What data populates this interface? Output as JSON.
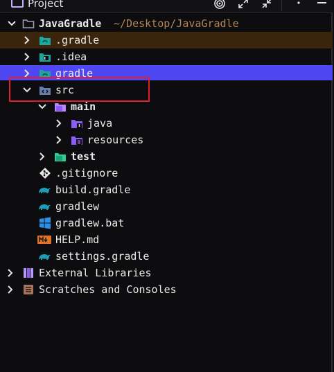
{
  "panel": {
    "title": "Project"
  },
  "colors": {
    "background": "#0d0d0f",
    "selected_row": "#4f48f2",
    "excluded_row": "#3b260d",
    "folder_gray": "#9aa2b4",
    "folder_teal": "#1aa7a0",
    "folder_purple": "#8b5cf6",
    "gradle_icon": "#1e9bb5",
    "annotation_box": "#e01e2e"
  },
  "tree": {
    "root": {
      "label": "JavaGradle",
      "path": "~/Desktop/JavaGradle",
      "icon": "folder-icon"
    },
    "dot_gradle": {
      "label": ".gradle",
      "icon": "folder-icon"
    },
    "dot_idea": {
      "label": ".idea",
      "icon": "folder-icon"
    },
    "gradle": {
      "label": "gradle",
      "icon": "folder-icon"
    },
    "src": {
      "label": "src",
      "icon": "source-folder-icon"
    },
    "main": {
      "label": "main",
      "icon": "folder-icon"
    },
    "java": {
      "label": "java",
      "icon": "java-folder-icon"
    },
    "resources": {
      "label": "resources",
      "icon": "resources-folder-icon"
    },
    "test": {
      "label": "test",
      "icon": "test-folder-icon"
    },
    "gitignore": {
      "label": ".gitignore",
      "icon": "git-icon"
    },
    "build_gradle": {
      "label": "build.gradle",
      "icon": "gradle-icon"
    },
    "gradlew": {
      "label": "gradlew",
      "icon": "gradle-icon"
    },
    "gradlew_bat": {
      "label": "gradlew.bat",
      "icon": "windows-icon"
    },
    "help_md": {
      "label": "HELP.md",
      "icon": "markdown-icon"
    },
    "settings_gradle": {
      "label": "settings.gradle",
      "icon": "gradle-icon"
    },
    "external_libraries": {
      "label": "External Libraries",
      "icon": "library-icon"
    },
    "scratches": {
      "label": "Scratches and Consoles",
      "icon": "scratches-icon"
    }
  }
}
